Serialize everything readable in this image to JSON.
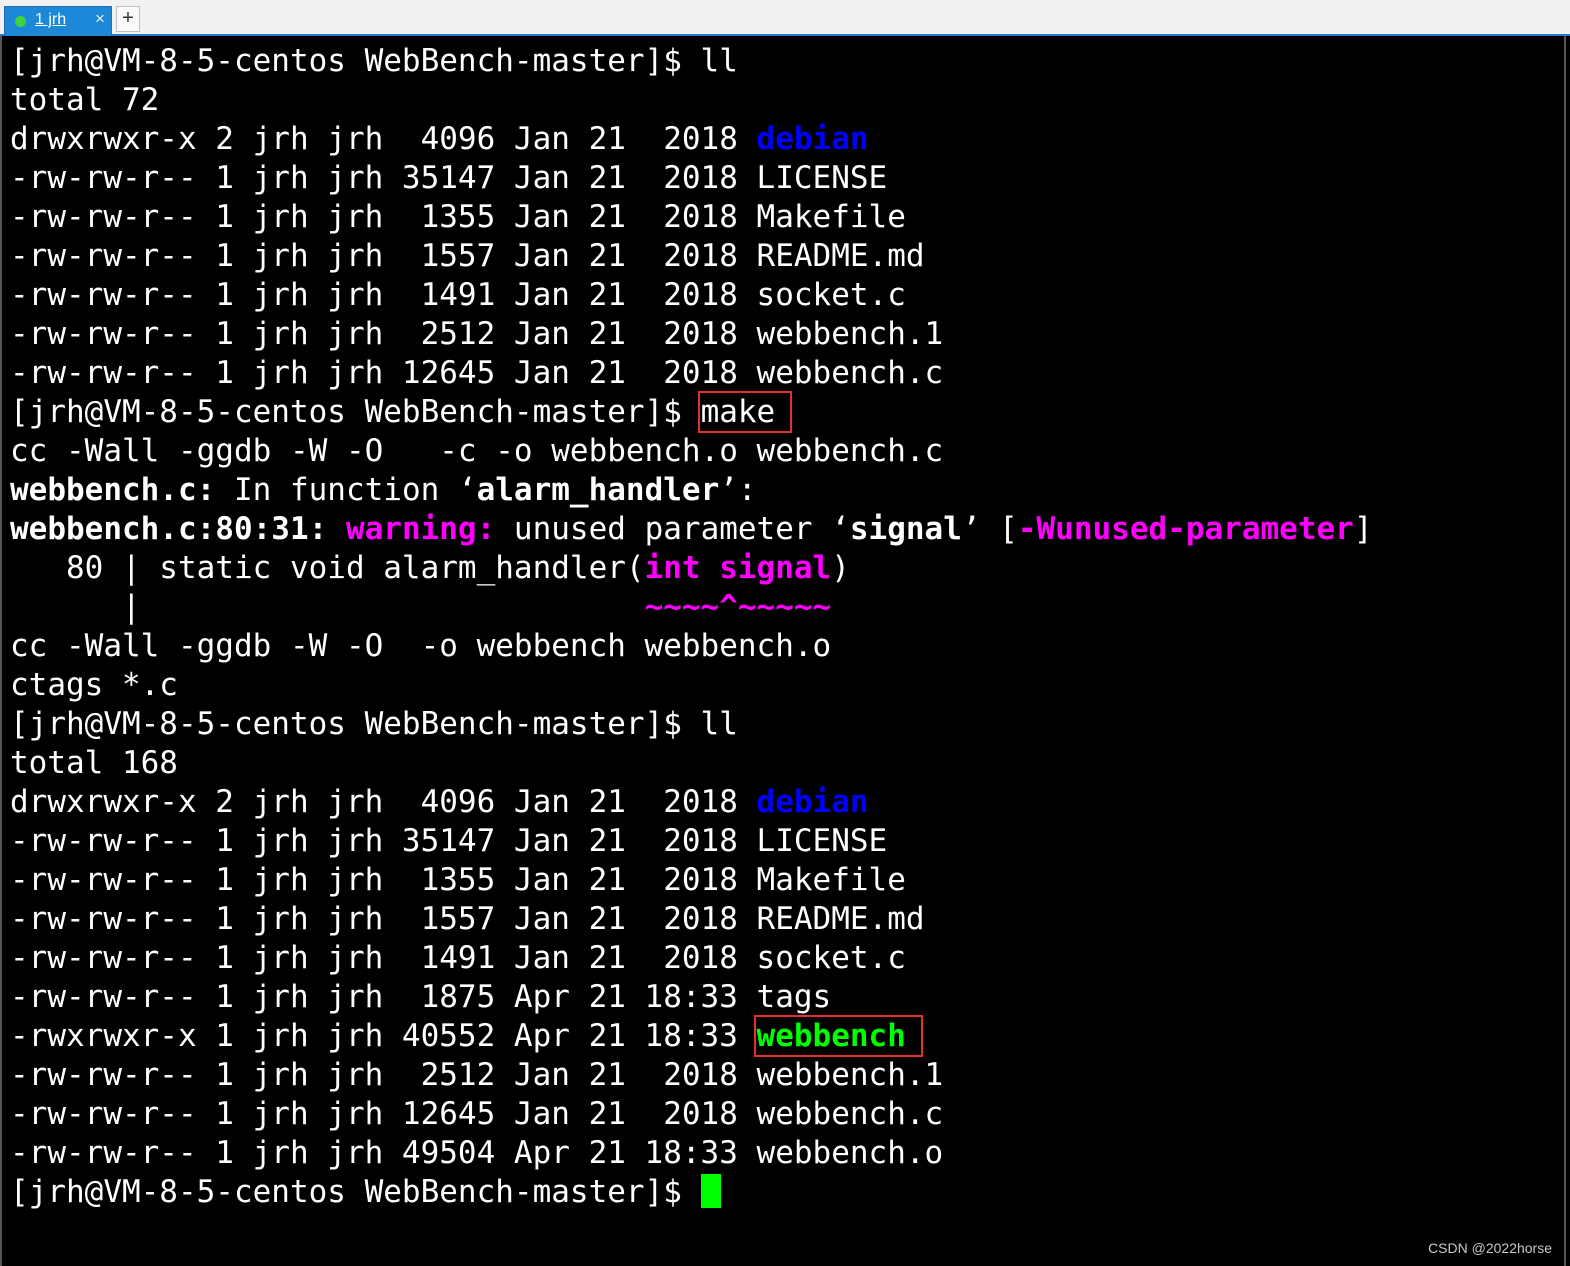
{
  "tabbar": {
    "tabs": [
      {
        "label": "1 jrh",
        "active": true,
        "status_color": "#3fd13f",
        "close_glyph": "×"
      }
    ],
    "new_tab_glyph": "+"
  },
  "terminal": {
    "cursor_color": "#00ff00",
    "colors": {
      "directory": "#0000ff",
      "executable": "#00ff00",
      "warning": "#ff00ff",
      "highlight_box": "#e03030"
    },
    "lines": [
      {
        "segments": [
          {
            "text": "[jrh@VM-8-5-centos WebBench-master]$ ll"
          }
        ]
      },
      {
        "segments": [
          {
            "text": "total 72"
          }
        ]
      },
      {
        "segments": [
          {
            "text": "drwxrwxr-x 2 jrh jrh  4096 Jan 21  2018 "
          },
          {
            "text": "debian",
            "style": "blue"
          }
        ]
      },
      {
        "segments": [
          {
            "text": "-rw-rw-r-- 1 jrh jrh 35147 Jan 21  2018 LICENSE"
          }
        ]
      },
      {
        "segments": [
          {
            "text": "-rw-rw-r-- 1 jrh jrh  1355 Jan 21  2018 Makefile"
          }
        ]
      },
      {
        "segments": [
          {
            "text": "-rw-rw-r-- 1 jrh jrh  1557 Jan 21  2018 README.md"
          }
        ]
      },
      {
        "segments": [
          {
            "text": "-rw-rw-r-- 1 jrh jrh  1491 Jan 21  2018 socket.c"
          }
        ]
      },
      {
        "segments": [
          {
            "text": "-rw-rw-r-- 1 jrh jrh  2512 Jan 21  2018 webbench.1"
          }
        ]
      },
      {
        "segments": [
          {
            "text": "-rw-rw-r-- 1 jrh jrh 12645 Jan 21  2018 webbench.c"
          }
        ]
      },
      {
        "segments": [
          {
            "text": "[jrh@VM-8-5-centos WebBench-master]$ "
          },
          {
            "text": "make",
            "style": "box"
          }
        ]
      },
      {
        "segments": [
          {
            "text": "cc -Wall -ggdb -W -O   -c -o webbench.o webbench.c"
          }
        ]
      },
      {
        "segments": [
          {
            "text": "webbench.c:",
            "style": "b"
          },
          {
            "text": " In function ‘"
          },
          {
            "text": "alarm_handler",
            "style": "b"
          },
          {
            "text": "’:"
          }
        ]
      },
      {
        "segments": [
          {
            "text": "webbench.c:80:31:",
            "style": "b"
          },
          {
            "text": " "
          },
          {
            "text": "warning:",
            "style": "b magenta"
          },
          {
            "text": " unused parameter ‘"
          },
          {
            "text": "signal",
            "style": "b"
          },
          {
            "text": "’ ["
          },
          {
            "text": "-Wunused-parameter",
            "style": "b magenta"
          },
          {
            "text": "]"
          }
        ]
      },
      {
        "segments": [
          {
            "text": "   80 | static void alarm_handler("
          },
          {
            "text": "int signal",
            "style": "b magenta"
          },
          {
            "text": ")"
          }
        ]
      },
      {
        "segments": [
          {
            "text": "      |                           "
          },
          {
            "text": "~~~~^~~~~~",
            "style": "b magenta"
          }
        ]
      },
      {
        "segments": [
          {
            "text": "cc -Wall -ggdb -W -O  -o webbench webbench.o"
          }
        ]
      },
      {
        "segments": [
          {
            "text": "ctags *.c"
          }
        ]
      },
      {
        "segments": [
          {
            "text": "[jrh@VM-8-5-centos WebBench-master]$ ll"
          }
        ]
      },
      {
        "segments": [
          {
            "text": "total 168"
          }
        ]
      },
      {
        "segments": [
          {
            "text": "drwxrwxr-x 2 jrh jrh  4096 Jan 21  2018 "
          },
          {
            "text": "debian",
            "style": "blue"
          }
        ]
      },
      {
        "segments": [
          {
            "text": "-rw-rw-r-- 1 jrh jrh 35147 Jan 21  2018 LICENSE"
          }
        ]
      },
      {
        "segments": [
          {
            "text": "-rw-rw-r-- 1 jrh jrh  1355 Jan 21  2018 Makefile"
          }
        ]
      },
      {
        "segments": [
          {
            "text": "-rw-rw-r-- 1 jrh jrh  1557 Jan 21  2018 README.md"
          }
        ]
      },
      {
        "segments": [
          {
            "text": "-rw-rw-r-- 1 jrh jrh  1491 Jan 21  2018 socket.c"
          }
        ]
      },
      {
        "segments": [
          {
            "text": "-rw-rw-r-- 1 jrh jrh  1875 Apr 21 18:33 tags"
          }
        ]
      },
      {
        "segments": [
          {
            "text": "-rwxrwxr-x 1 jrh jrh 40552 Apr 21 18:33 "
          },
          {
            "text": "webbench",
            "style": "green box"
          }
        ]
      },
      {
        "segments": [
          {
            "text": "-rw-rw-r-- 1 jrh jrh  2512 Jan 21  2018 webbench.1"
          }
        ]
      },
      {
        "segments": [
          {
            "text": "-rw-rw-r-- 1 jrh jrh 12645 Jan 21  2018 webbench.c"
          }
        ]
      },
      {
        "segments": [
          {
            "text": "-rw-rw-r-- 1 jrh jrh 49504 Apr 21 18:33 webbench.o"
          }
        ]
      },
      {
        "segments": [
          {
            "text": "[jrh@VM-8-5-centos WebBench-master]$ "
          },
          {
            "text": "",
            "style": "cursor"
          }
        ]
      }
    ]
  },
  "watermark": "CSDN @2022horse"
}
